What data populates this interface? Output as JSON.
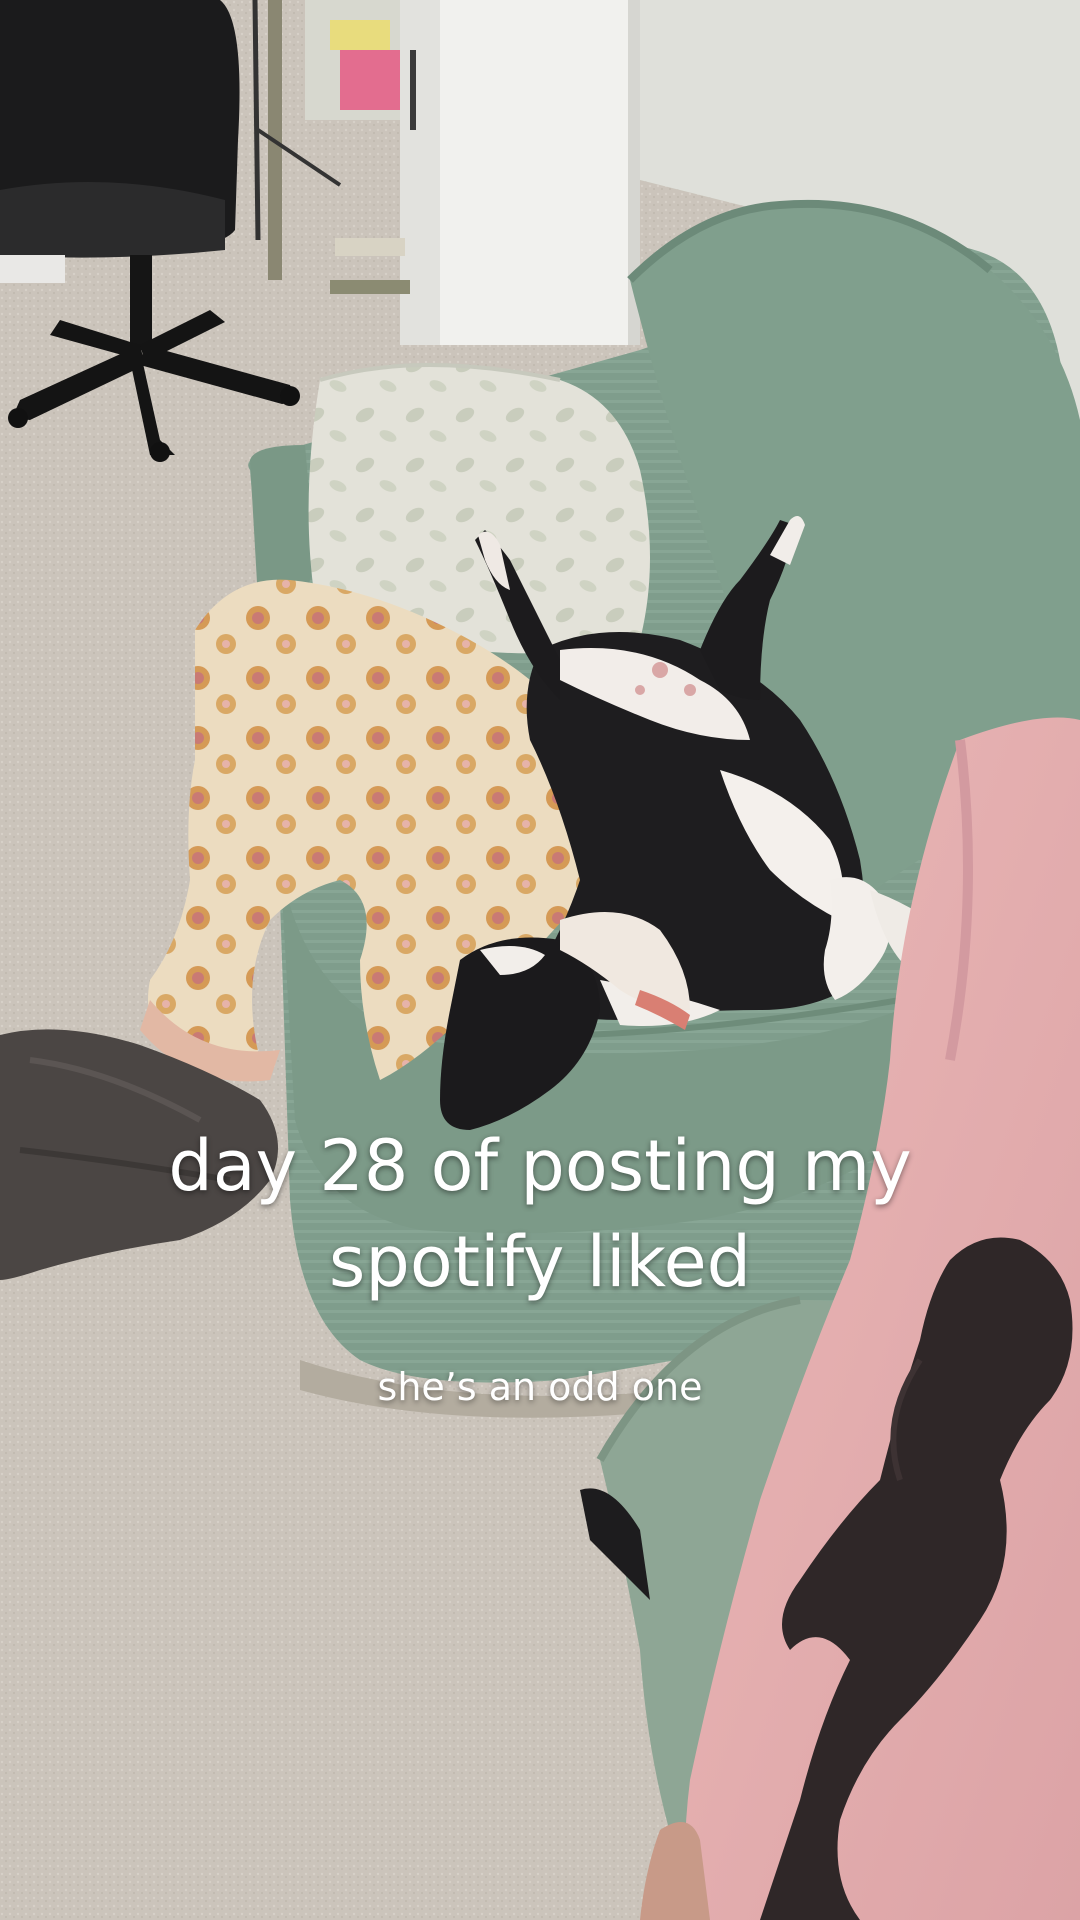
{
  "video": {
    "caption_line_1": "day 28 of posting my",
    "caption_line_2": "spotify liked",
    "subcaption": "she’s an odd one"
  },
  "colors": {
    "carpet": "#cdc6bd",
    "couch": "#7e9c8b",
    "wall": "#dfe0db",
    "dog_black": "#1c1b1d",
    "dog_white": "#f3efec",
    "blanket": "#e4c48f",
    "pink_hoodie": "#e9b7b8",
    "caption_text": "#ffffff"
  }
}
